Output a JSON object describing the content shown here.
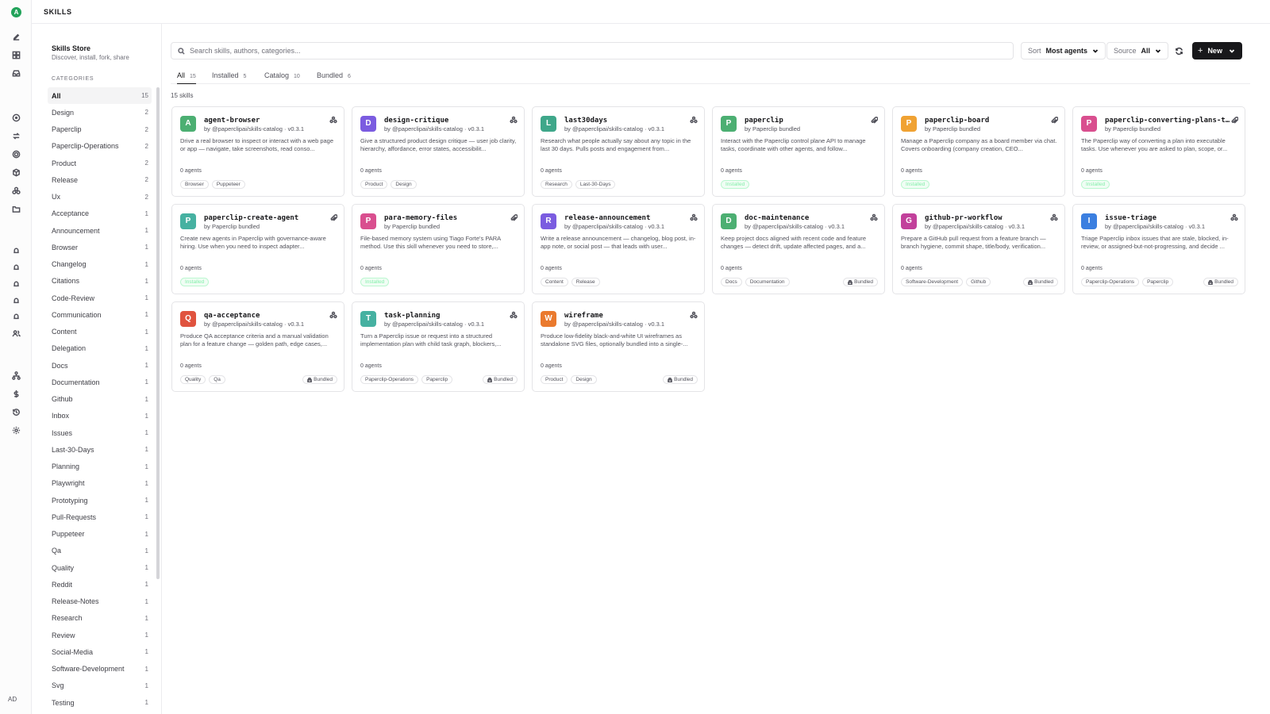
{
  "header": {
    "title": "SKILLS"
  },
  "rail": {
    "workspace_initial": "A",
    "user_initials": "AD"
  },
  "store": {
    "title": "Skills Store",
    "subtitle": "Discover, install, fork, share",
    "categories_heading": "CATEGORIES"
  },
  "categories": [
    {
      "label": "All",
      "count": "15"
    },
    {
      "label": "Design",
      "count": "2"
    },
    {
      "label": "Paperclip",
      "count": "2"
    },
    {
      "label": "Paperclip-Operations",
      "count": "2"
    },
    {
      "label": "Product",
      "count": "2"
    },
    {
      "label": "Release",
      "count": "2"
    },
    {
      "label": "Ux",
      "count": "2"
    },
    {
      "label": "Acceptance",
      "count": "1"
    },
    {
      "label": "Announcement",
      "count": "1"
    },
    {
      "label": "Browser",
      "count": "1"
    },
    {
      "label": "Changelog",
      "count": "1"
    },
    {
      "label": "Citations",
      "count": "1"
    },
    {
      "label": "Code-Review",
      "count": "1"
    },
    {
      "label": "Communication",
      "count": "1"
    },
    {
      "label": "Content",
      "count": "1"
    },
    {
      "label": "Delegation",
      "count": "1"
    },
    {
      "label": "Docs",
      "count": "1"
    },
    {
      "label": "Documentation",
      "count": "1"
    },
    {
      "label": "Github",
      "count": "1"
    },
    {
      "label": "Inbox",
      "count": "1"
    },
    {
      "label": "Issues",
      "count": "1"
    },
    {
      "label": "Last-30-Days",
      "count": "1"
    },
    {
      "label": "Planning",
      "count": "1"
    },
    {
      "label": "Playwright",
      "count": "1"
    },
    {
      "label": "Prototyping",
      "count": "1"
    },
    {
      "label": "Pull-Requests",
      "count": "1"
    },
    {
      "label": "Puppeteer",
      "count": "1"
    },
    {
      "label": "Qa",
      "count": "1"
    },
    {
      "label": "Quality",
      "count": "1"
    },
    {
      "label": "Reddit",
      "count": "1"
    },
    {
      "label": "Release-Notes",
      "count": "1"
    },
    {
      "label": "Research",
      "count": "1"
    },
    {
      "label": "Review",
      "count": "1"
    },
    {
      "label": "Social-Media",
      "count": "1"
    },
    {
      "label": "Software-Development",
      "count": "1"
    },
    {
      "label": "Svg",
      "count": "1"
    },
    {
      "label": "Testing",
      "count": "1"
    }
  ],
  "toolbar": {
    "search_placeholder": "Search skills, authors, categories...",
    "sort_label": "Sort",
    "sort_value": "Most agents",
    "source_label": "Source",
    "source_value": "All",
    "new_label": "New"
  },
  "tabs": [
    {
      "label": "All",
      "count": "15"
    },
    {
      "label": "Installed",
      "count": "5"
    },
    {
      "label": "Catalog",
      "count": "10"
    },
    {
      "label": "Bundled",
      "count": "6"
    }
  ],
  "skills_count": "15 skills",
  "colors": {
    "green": "#4caf72",
    "purple": "#7b5ce0",
    "teal": "#3fa78a",
    "orange": "#f0a233",
    "pink": "#d94f8f",
    "magenta": "#c2409b",
    "blue": "#3b7fe0",
    "red": "#e0533f",
    "teal2": "#46b1a1",
    "ember": "#ea7a2e"
  },
  "skills": [
    {
      "initial": "A",
      "color": "#4caf72",
      "name": "agent-browser",
      "author": "by @paperclipai/skills-catalog · v0.3.1",
      "description": "Drive a real browser to inspect or interact with a web page or app — navigate, take screenshots, read conso...",
      "agents": "0 agents",
      "tags": [
        "Browser",
        "Puppeteer"
      ],
      "badge": "",
      "kind_icon": "catalog-icon"
    },
    {
      "initial": "D",
      "color": "#7b5ce0",
      "name": "design-critique",
      "author": "by @paperclipai/skills-catalog · v0.3.1",
      "description": "Give a structured product design critique — user job clarity, hierarchy, affordance, error states, accessibilit...",
      "agents": "0 agents",
      "tags": [
        "Product",
        "Design"
      ],
      "badge": "",
      "kind_icon": "catalog-icon"
    },
    {
      "initial": "L",
      "color": "#3fa78a",
      "name": "last30days",
      "author": "by @paperclipai/skills-catalog · v0.3.1",
      "description": "Research what people actually say about any topic in the last 30 days. Pulls posts and engagement from...",
      "agents": "0 agents",
      "tags": [
        "Research",
        "Last-30-Days"
      ],
      "badge": "",
      "kind_icon": "catalog-icon"
    },
    {
      "initial": "P",
      "color": "#4caf72",
      "name": "paperclip",
      "author": "by Paperclip bundled",
      "description": "Interact with the Paperclip control plane API to manage tasks, coordinate with other agents, and follow...",
      "agents": "0 agents",
      "tags": [
        "Installed"
      ],
      "badge": "",
      "kind_icon": "paperclip-icon"
    },
    {
      "initial": "P",
      "color": "#f0a233",
      "name": "paperclip-board",
      "author": "by Paperclip bundled",
      "description": "Manage a Paperclip company as a board member via chat. Covers onboarding (company creation, CEO...",
      "agents": "0 agents",
      "tags": [
        "Installed"
      ],
      "badge": "",
      "kind_icon": "paperclip-icon"
    },
    {
      "initial": "P",
      "color": "#d94f8f",
      "name": "paperclip-converting-plans-to-tasks",
      "author": "by Paperclip bundled",
      "description": "The Paperclip way of converting a plan into executable tasks. Use whenever you are asked to plan, scope, or...",
      "agents": "0 agents",
      "tags": [
        "Installed"
      ],
      "badge": "",
      "kind_icon": "paperclip-icon"
    },
    {
      "initial": "P",
      "color": "#46b1a1",
      "name": "paperclip-create-agent",
      "author": "by Paperclip bundled",
      "description": "Create new agents in Paperclip with governance-aware hiring. Use when you need to inspect adapter...",
      "agents": "0 agents",
      "tags": [
        "Installed"
      ],
      "badge": "",
      "kind_icon": "paperclip-icon"
    },
    {
      "initial": "P",
      "color": "#d94f8f",
      "name": "para-memory-files",
      "author": "by Paperclip bundled",
      "description": "File-based memory system using Tiago Forte's PARA method. Use this skill whenever you need to store,...",
      "agents": "0 agents",
      "tags": [
        "Installed"
      ],
      "badge": "",
      "kind_icon": "paperclip-icon"
    },
    {
      "initial": "R",
      "color": "#7b5ce0",
      "name": "release-announcement",
      "author": "by @paperclipai/skills-catalog · v0.3.1",
      "description": "Write a release announcement — changelog, blog post, in-app note, or social post — that leads with user...",
      "agents": "0 agents",
      "tags": [
        "Content",
        "Release"
      ],
      "badge": "",
      "kind_icon": "catalog-icon"
    },
    {
      "initial": "D",
      "color": "#4caf72",
      "name": "doc-maintenance",
      "author": "by @paperclipai/skills-catalog · v0.3.1",
      "description": "Keep project docs aligned with recent code and feature changes — detect drift, update affected pages, and a...",
      "agents": "0 agents",
      "tags": [
        "Docs",
        "Documentation"
      ],
      "badge": "Bundled",
      "kind_icon": "catalog-icon"
    },
    {
      "initial": "G",
      "color": "#c2409b",
      "name": "github-pr-workflow",
      "author": "by @paperclipai/skills-catalog · v0.3.1",
      "description": "Prepare a GitHub pull request from a feature branch — branch hygiene, commit shape, title/body, verification...",
      "agents": "0 agents",
      "tags": [
        "Software-Development",
        "Github"
      ],
      "badge": "Bundled",
      "kind_icon": "catalog-icon"
    },
    {
      "initial": "I",
      "color": "#3b7fe0",
      "name": "issue-triage",
      "author": "by @paperclipai/skills-catalog · v0.3.1",
      "description": "Triage Paperclip inbox issues that are stale, blocked, in-review, or assigned-but-not-progressing, and decide ...",
      "agents": "0 agents",
      "tags": [
        "Paperclip-Operations",
        "Paperclip"
      ],
      "badge": "Bundled",
      "kind_icon": "catalog-icon"
    },
    {
      "initial": "Q",
      "color": "#e0533f",
      "name": "qa-acceptance",
      "author": "by @paperclipai/skills-catalog · v0.3.1",
      "description": "Produce QA acceptance criteria and a manual validation plan for a feature change — golden path, edge cases,...",
      "agents": "0 agents",
      "tags": [
        "Quality",
        "Qa"
      ],
      "badge": "Bundled",
      "kind_icon": "catalog-icon"
    },
    {
      "initial": "T",
      "color": "#46b1a1",
      "name": "task-planning",
      "author": "by @paperclipai/skills-catalog · v0.3.1",
      "description": "Turn a Paperclip issue or request into a structured implementation plan with child task graph, blockers,...",
      "agents": "0 agents",
      "tags": [
        "Paperclip-Operations",
        "Paperclip"
      ],
      "badge": "Bundled",
      "kind_icon": "catalog-icon"
    },
    {
      "initial": "W",
      "color": "#ea7a2e",
      "name": "wireframe",
      "author": "by @paperclipai/skills-catalog · v0.3.1",
      "description": "Produce low-fidelity black-and-white UI wireframes as standalone SVG files, optionally bundled into a single-...",
      "agents": "0 agents",
      "tags": [
        "Product",
        "Design"
      ],
      "badge": "Bundled",
      "kind_icon": "catalog-icon"
    }
  ]
}
